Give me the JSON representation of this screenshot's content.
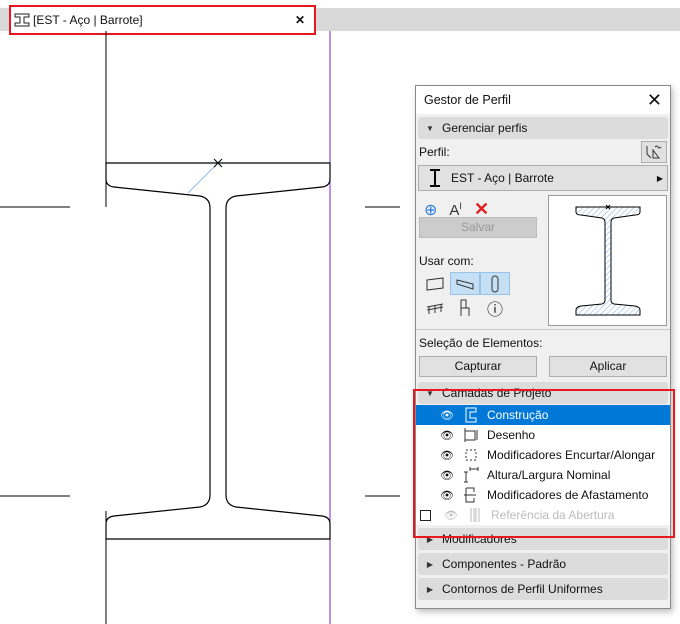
{
  "tab": {
    "title": "[EST - Aço | Barrote]",
    "icon": "i-beam-icon"
  },
  "panel": {
    "title": "Gestor de Perfil",
    "manage_section": "Gerenciar perfis",
    "profile_label": "Perfil:",
    "profile_value": "EST - Aço | Barrote",
    "save_label": "Salvar",
    "use_with_label": "Usar com:",
    "selection_label": "Seleção de Elementos:",
    "capture_label": "Capturar",
    "apply_label": "Aplicar",
    "layers_section": "Camadas de Projeto",
    "layers": [
      {
        "label": "Construção",
        "visible": true,
        "selected": true
      },
      {
        "label": "Desenho",
        "visible": true
      },
      {
        "label": "Modificadores Encurtar/Alongar",
        "visible": true
      },
      {
        "label": "Altura/Largura Nominal",
        "visible": true
      },
      {
        "label": "Modificadores de Afastamento",
        "visible": true
      },
      {
        "label": "Referência da Abertura",
        "visible": false,
        "disabled": true
      }
    ],
    "sections": [
      "Modificadores",
      "Componentes - Padrão",
      "Contornos de Perfil Uniformes"
    ]
  },
  "colors": {
    "accent": "#0078d7",
    "highlight": "#e8191e",
    "guide": "#7a1fd6"
  }
}
